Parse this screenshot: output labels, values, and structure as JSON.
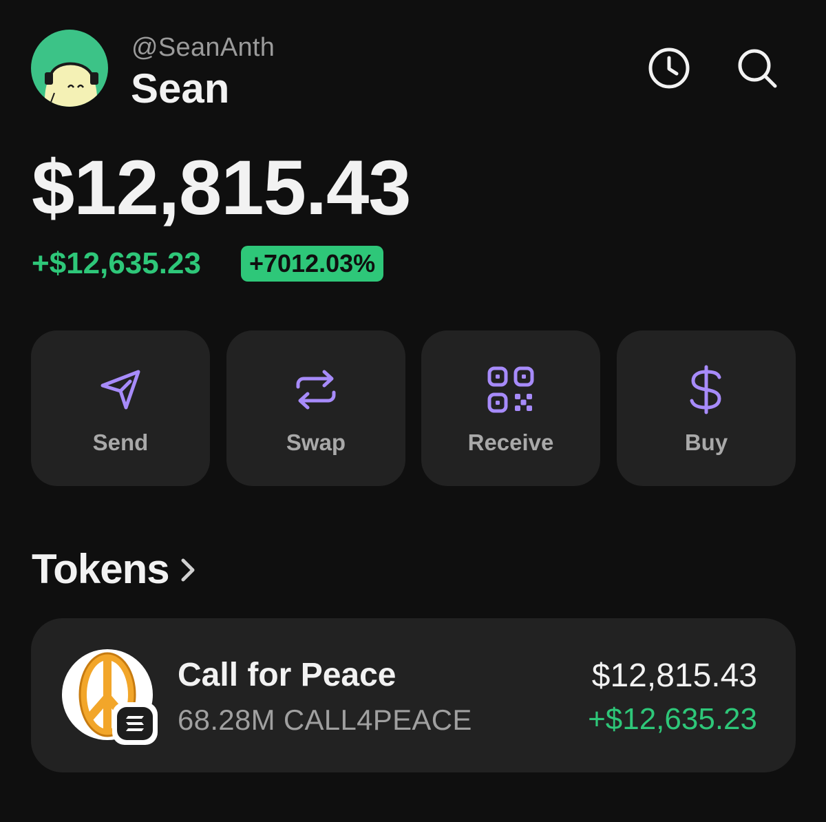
{
  "profile": {
    "handle": "@SeanAnth",
    "name": "Sean",
    "avatar_color": "#3cc387"
  },
  "header": {
    "history_icon": "clock-icon",
    "search_icon": "search-icon"
  },
  "portfolio": {
    "balance": "$12,815.43",
    "change": "+$12,635.23",
    "change_pct": "+7012.03%",
    "positive_color": "#2ec779"
  },
  "actions": [
    {
      "label": "Send",
      "icon": "send-icon"
    },
    {
      "label": "Swap",
      "icon": "swap-arrows-icon"
    },
    {
      "label": "Receive",
      "icon": "qr-code-icon"
    },
    {
      "label": "Buy",
      "icon": "dollar-icon"
    }
  ],
  "accent_color": "#a78bfa",
  "tokens": {
    "title": "Tokens",
    "items": [
      {
        "name": "Call for Peace",
        "amount": "68.28M CALL4PEACE",
        "value": "$12,815.43",
        "change": "+$12,635.23",
        "logo": "peace-sign-icon",
        "chain": "solana-icon"
      }
    ]
  }
}
